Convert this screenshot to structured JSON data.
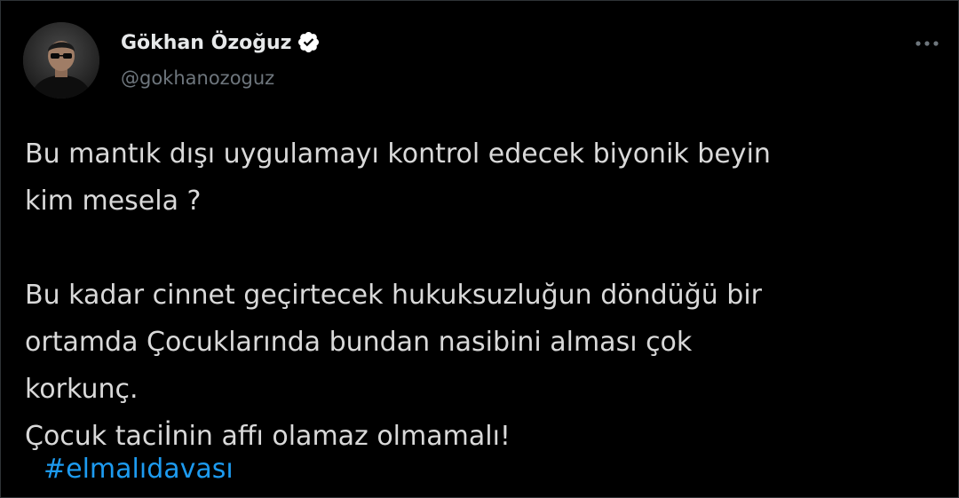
{
  "author": {
    "display_name": "Gökhan Özoğuz",
    "handle": "@gokhanozoguz",
    "verified": true
  },
  "menu_icon": "more-horizontal-icon",
  "tweet": {
    "paragraph_1": "Bu mantık dışı uygulamayı kontrol edecek biyonik beyin\nkim mesela ?",
    "paragraph_2": "Bu kadar cinnet geçirtecek hukuksuzluğun döndüğü bir\nortamda Çocuklarında bundan nasibini alması çok\nkorkunç.\nÇocuk taciİnin affı olamaz olmamalı!",
    "hashtag": "#elmalıdavası"
  },
  "colors": {
    "background": "#000000",
    "text": "#d9d9d9",
    "handle": "#6e767d",
    "link": "#1d9bf0",
    "verified_badge": "#ffffff"
  }
}
